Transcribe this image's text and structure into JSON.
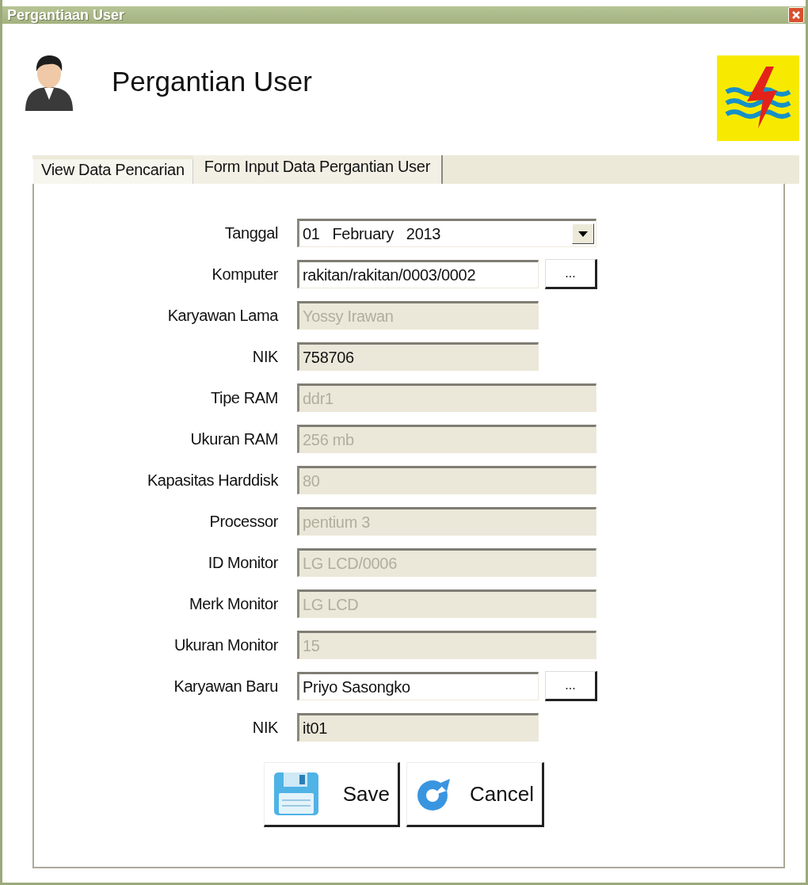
{
  "window": {
    "title": "Pergantiaan User"
  },
  "header": {
    "title": "Pergantian User"
  },
  "tabs": [
    {
      "label": "View Data Pencarian",
      "selected": false
    },
    {
      "label": "Form Input Data Pergantian User",
      "selected": true
    }
  ],
  "fields": [
    {
      "label": "Tanggal",
      "kind": "date",
      "value": "01   February   2013",
      "read_only": false,
      "disabled": false
    },
    {
      "label": "Komputer",
      "kind": "browse",
      "value": "rakitan/rakitan/0003/0002",
      "button": "...",
      "read_only": false,
      "disabled": false
    },
    {
      "label": "Karyawan Lama",
      "kind": "linked",
      "value": "Yossy Irawan",
      "read_only": true,
      "disabled": true
    },
    {
      "label": "NIK",
      "kind": "linked",
      "value": "758706",
      "read_only": true,
      "disabled": false
    },
    {
      "label": "Tipe RAM",
      "kind": "spec",
      "value": "ddr1",
      "read_only": true,
      "disabled": true
    },
    {
      "label": "Ukuran RAM",
      "kind": "spec",
      "value": "256 mb",
      "read_only": true,
      "disabled": true
    },
    {
      "label": "Kapasitas Harddisk",
      "kind": "spec",
      "value": "80",
      "read_only": true,
      "disabled": true
    },
    {
      "label": "Processor",
      "kind": "spec",
      "value": "pentium 3",
      "read_only": true,
      "disabled": true
    },
    {
      "label": "ID Monitor",
      "kind": "spec",
      "value": "LG LCD/0006",
      "read_only": true,
      "disabled": true
    },
    {
      "label": "Merk Monitor",
      "kind": "spec",
      "value": "LG LCD",
      "read_only": true,
      "disabled": true
    },
    {
      "label": "Ukuran Monitor",
      "kind": "spec",
      "value": "15",
      "read_only": true,
      "disabled": true
    },
    {
      "label": "Karyawan Baru",
      "kind": "browse",
      "value": "Priyo Sasongko",
      "button": "...",
      "read_only": false,
      "disabled": false
    },
    {
      "label": "NIK",
      "kind": "linked",
      "value": "it01",
      "read_only": true,
      "disabled": false
    }
  ],
  "buttons": [
    {
      "label": "Save",
      "kind": "save"
    },
    {
      "label": "Cancel",
      "kind": "cancel"
    }
  ]
}
